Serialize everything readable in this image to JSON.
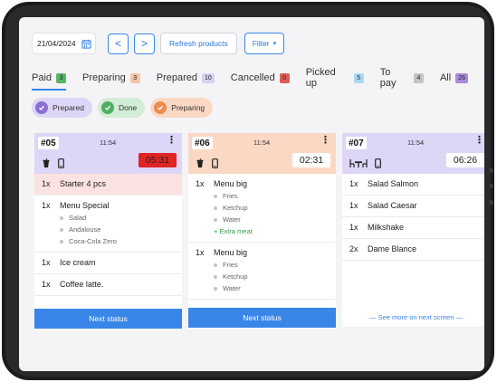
{
  "toolbar": {
    "date": "21/04/2024",
    "prev": "<",
    "next": ">",
    "refresh_label": "Refresh products",
    "filter_label": "Filter",
    "filter_caret": "▾"
  },
  "tabs": [
    {
      "label": "Paid",
      "count": "3",
      "color": "#57b56a"
    },
    {
      "label": "Preparing",
      "count": "3",
      "color": "#f6c4a7"
    },
    {
      "label": "Prepared",
      "count": "10",
      "color": "#d8d0f2"
    },
    {
      "label": "Cancelled",
      "count": "0",
      "color": "#e05a5a"
    },
    {
      "label": "Picked up",
      "count": "5",
      "color": "#a9d8f3"
    },
    {
      "label": "To pay",
      "count": "4",
      "color": "#c4c4c8"
    },
    {
      "label": "All",
      "count": "26",
      "color": "#a88ad9"
    }
  ],
  "chips": [
    {
      "label": "Prepared",
      "bg": "#ddd6f6",
      "icon_bg": "#8a6fd6"
    },
    {
      "label": "Done",
      "bg": "#d3ecd6",
      "icon_bg": "#4caf64"
    },
    {
      "label": "Preparing",
      "bg": "#fbd8c4",
      "icon_bg": "#f08a4e"
    }
  ],
  "cards": [
    {
      "number": "#05",
      "time": "11:54",
      "menu": "⋮",
      "timer": "05:31",
      "head_bg": "#ddd6f6",
      "timer_bg": "#e02424",
      "timer_color": "#222222",
      "items": [
        {
          "qty": "1x",
          "name": "Starter 4 pcs",
          "highlight": true,
          "subs": []
        },
        {
          "qty": "1x",
          "name": "Menu Special",
          "subs": [
            "Salad",
            "Andalouse",
            "Coca-Cola Zero"
          ]
        },
        {
          "qty": "1x",
          "name": "Ice cream",
          "subs": []
        },
        {
          "qty": "1x",
          "name": "Coffee latte.",
          "subs": []
        }
      ],
      "action": "Next status"
    },
    {
      "number": "#06",
      "time": "11:54",
      "menu": "⋮",
      "timer": "02:31",
      "head_bg": "#fbd8c4",
      "timer_bg": "#ffffff",
      "timer_color": "#222222",
      "items": [
        {
          "qty": "1x",
          "name": "Menu big",
          "subs": [
            "Fries",
            "Ketchup",
            "Water"
          ],
          "extra": "+ Extra meat"
        },
        {
          "qty": "1x",
          "name": "Menu big",
          "subs": [
            "Fries",
            "Ketchup",
            "Water"
          ]
        }
      ],
      "action": "Next status"
    },
    {
      "number": "#07",
      "time": "11:54",
      "menu": "⋮",
      "timer": "06:26",
      "head_bg": "#ddd6f6",
      "timer_bg": "#ffffff",
      "timer_color": "#222222",
      "items": [
        {
          "qty": "1x",
          "name": "Salad Salmon",
          "subs": []
        },
        {
          "qty": "1x",
          "name": "Salad Caesar",
          "subs": []
        },
        {
          "qty": "1x",
          "name": "Milkshake",
          "subs": []
        },
        {
          "qty": "2x",
          "name": "Dame Blance",
          "subs": []
        }
      ],
      "see_more": "— See more on next screen —"
    }
  ]
}
